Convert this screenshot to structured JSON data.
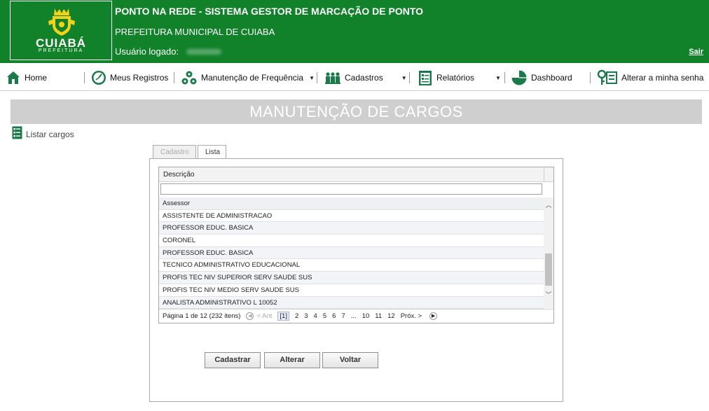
{
  "header": {
    "logo_text": "CUIABÁ",
    "logo_sub": "PREFEITURA",
    "title": "PONTO NA REDE - SISTEMA GESTOR DE MARCAÇÃO DE PONTO",
    "subtitle": "PREFEITURA MUNICIPAL DE CUIABA",
    "user_label": "Usuário logado:",
    "logout": "Sair"
  },
  "nav": {
    "items": [
      {
        "label": "Home",
        "icon": "home-icon"
      },
      {
        "label": "Meus Registros",
        "icon": "clock-icon"
      },
      {
        "label": "Manutenção de Frequência",
        "icon": "gears-icon",
        "caret": "▼"
      },
      {
        "label": "Cadastros",
        "icon": "people-icon",
        "caret": "▼"
      },
      {
        "label": "Relatórios",
        "icon": "report-icon",
        "caret": "▼"
      },
      {
        "label": "Dashboard",
        "icon": "pie-chart-icon"
      },
      {
        "label": "Alterar a minha senha",
        "icon": "key-icon"
      }
    ]
  },
  "page": {
    "title": "MANUTENÇÃO DE CARGOS",
    "list_link": "Listar cargos"
  },
  "tabs": [
    {
      "label": "Cadastro",
      "active": false
    },
    {
      "label": "Lista",
      "active": true
    }
  ],
  "grid": {
    "column_header": "Descrição",
    "filter_value": "",
    "rows": [
      "Assessor",
      "ASSISTENTE DE ADMINISTRACAO",
      "PROFESSOR EDUC. BASICA",
      "CORONEL",
      "PROFESSOR EDUC. BASICA",
      "TECNICO ADMINISTRATIVO EDUCACIONAL",
      "PROFIS TEC NIV SUPERIOR SERV SAUDE SUS",
      "PROFIS TEC NIV MEDIO SERV SAUDE SUS",
      "ANALISTA ADMINISTRATIVO L 10052"
    ],
    "pager": {
      "summary": "Página 1 de 12 (232 itens)",
      "prev": "< Ant",
      "current": "[1]",
      "pages": [
        "2",
        "3",
        "4",
        "5",
        "6",
        "7",
        "...",
        "10",
        "11",
        "12"
      ],
      "next": "Próx. >"
    }
  },
  "buttons": {
    "cadastrar": "Cadastrar",
    "alterar": "Alterar",
    "voltar": "Voltar"
  },
  "colors": {
    "brand_green": "#11822a",
    "title_bar": "#cfcfcf"
  }
}
